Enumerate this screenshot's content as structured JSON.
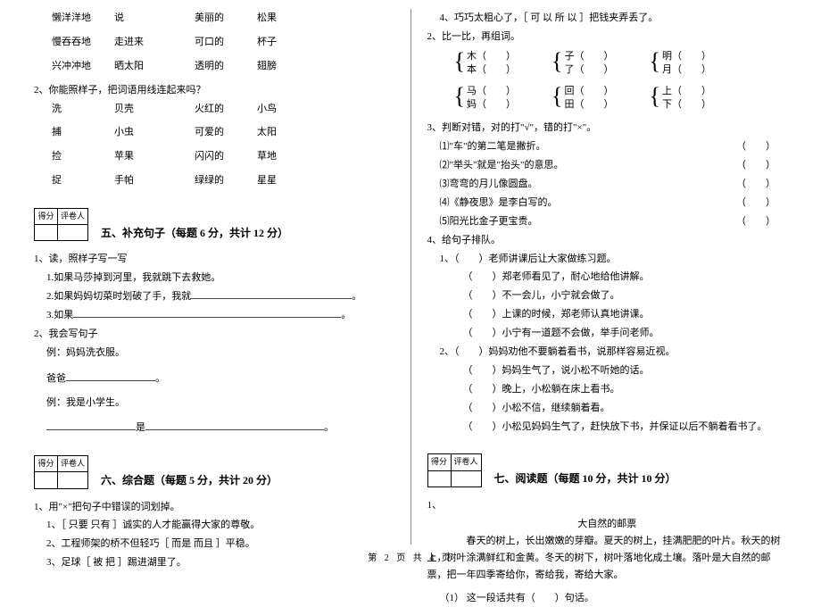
{
  "left": {
    "word_rows": [
      [
        "懒洋洋地",
        "说",
        "美丽的",
        "松果"
      ],
      [
        "慢吞吞地",
        "走进来",
        "可口的",
        "杯子"
      ],
      [
        "兴冲冲地",
        "晒太阳",
        "透明的",
        "翅膀"
      ]
    ],
    "q2_head": "2、你能照样子，把词语用线连起来吗？",
    "match_rows": [
      [
        "洗",
        "贝壳",
        "火红的",
        "小鸟"
      ],
      [
        "捕",
        "小虫",
        "可爱的",
        "太阳"
      ],
      [
        "捡",
        "苹果",
        "闪闪的",
        "草地"
      ],
      [
        "捉",
        "手帕",
        "绿绿的",
        "星星"
      ]
    ],
    "score_head": [
      "得分",
      "评卷人"
    ],
    "sec5": "五、补充句子（每题 6 分，共计 12 分）",
    "q5_1": "1、读，照样子写一写",
    "q5_1_ex": "1.如果马莎掉到河里，我就跳下去救她。",
    "q5_1_2": "2.如果妈妈切菜时划破了手，我就",
    "q5_1_3": "3.如果",
    "q5_2": "2、我会写句子",
    "q5_2_ex": "例：妈妈洗衣服。",
    "q5_2_ba": "爸爸",
    "q5_2_ex2": "例：我是小学生。",
    "q5_2_shi": "是",
    "sec6": "六、综合题（每题 5 分，共计 20 分）",
    "q6_1": "1、用\"×\"把句子中错误的词划掉。",
    "q6_1_1": "1、［ 只要    只有 ］诚实的人才能赢得大家的尊敬。",
    "q6_1_2": "2、工程师架的桥不但轻巧［ 而是    而且 ］平稳。",
    "q6_1_3": "3、足球［ 被    把 ］踢进湖里了。"
  },
  "right": {
    "q4": "4、巧巧太粗心了，［ 可 以    所 以 ］把钱夹弄丢了。",
    "q2_head": "2、比一比，再组词。",
    "pairs1": [
      [
        "木",
        "本"
      ],
      [
        "子",
        "了"
      ],
      [
        "明",
        "月"
      ]
    ],
    "pairs2": [
      [
        "马",
        "妈"
      ],
      [
        "回",
        "田"
      ],
      [
        "上",
        "下"
      ]
    ],
    "q3_head": "3、判断对错，对的打\"√\"，错的打\"×\"。",
    "q3_items": [
      "⑴\"车\"的第二笔是撇折。",
      "⑵\"举头\"就是\"抬头\"的意思。",
      "⑶弯弯的月儿像圆盘。",
      "⑷《静夜思》是李白写的。",
      "⑸阳光比金子更宝贵。"
    ],
    "q4_head": "4、给句子排队。",
    "q4_1": "1、（　　）老师讲课后让大家做练习题。",
    "q4_1_items": [
      "（　　）郑老师看见了，耐心地给他讲解。",
      "（　　）不一会儿，小宁就会做了。",
      "（　　）上课的时候，郑老师认真地讲课。",
      "（　　）小宁有一道题不会做，举手问老师。"
    ],
    "q4_2": "2、（　　）妈妈劝他不要躺着看书，说那样容易近视。",
    "q4_2_items": [
      "（　　）妈妈生气了，说小松不听她的话。",
      "（　　）晚上，小松躺在床上看书。",
      "（　　）小松不信，继续躺着看。",
      "（　　）小松见妈妈生气了，赶快放下书，并保证以后不躺着看书了。"
    ],
    "sec7": "七、阅读题（每题 10 分，共计 10 分）",
    "read_num": "1、",
    "read_title": "大自然的邮票",
    "read_body": "　　春天的树上，长出嫩嫩的芽瓣。夏天的树上，挂满肥肥的叶片。秋天的树上，树叶涂满鲜红和金黄。冬天的树下，树叶落地化成土壤。落叶是大自然的邮票，把一年四季寄给你，寄给我，寄给大家。",
    "read_q1": "（1） 这一段话共有（　　）句话。"
  },
  "footer": "第 2 页 共 4 页"
}
